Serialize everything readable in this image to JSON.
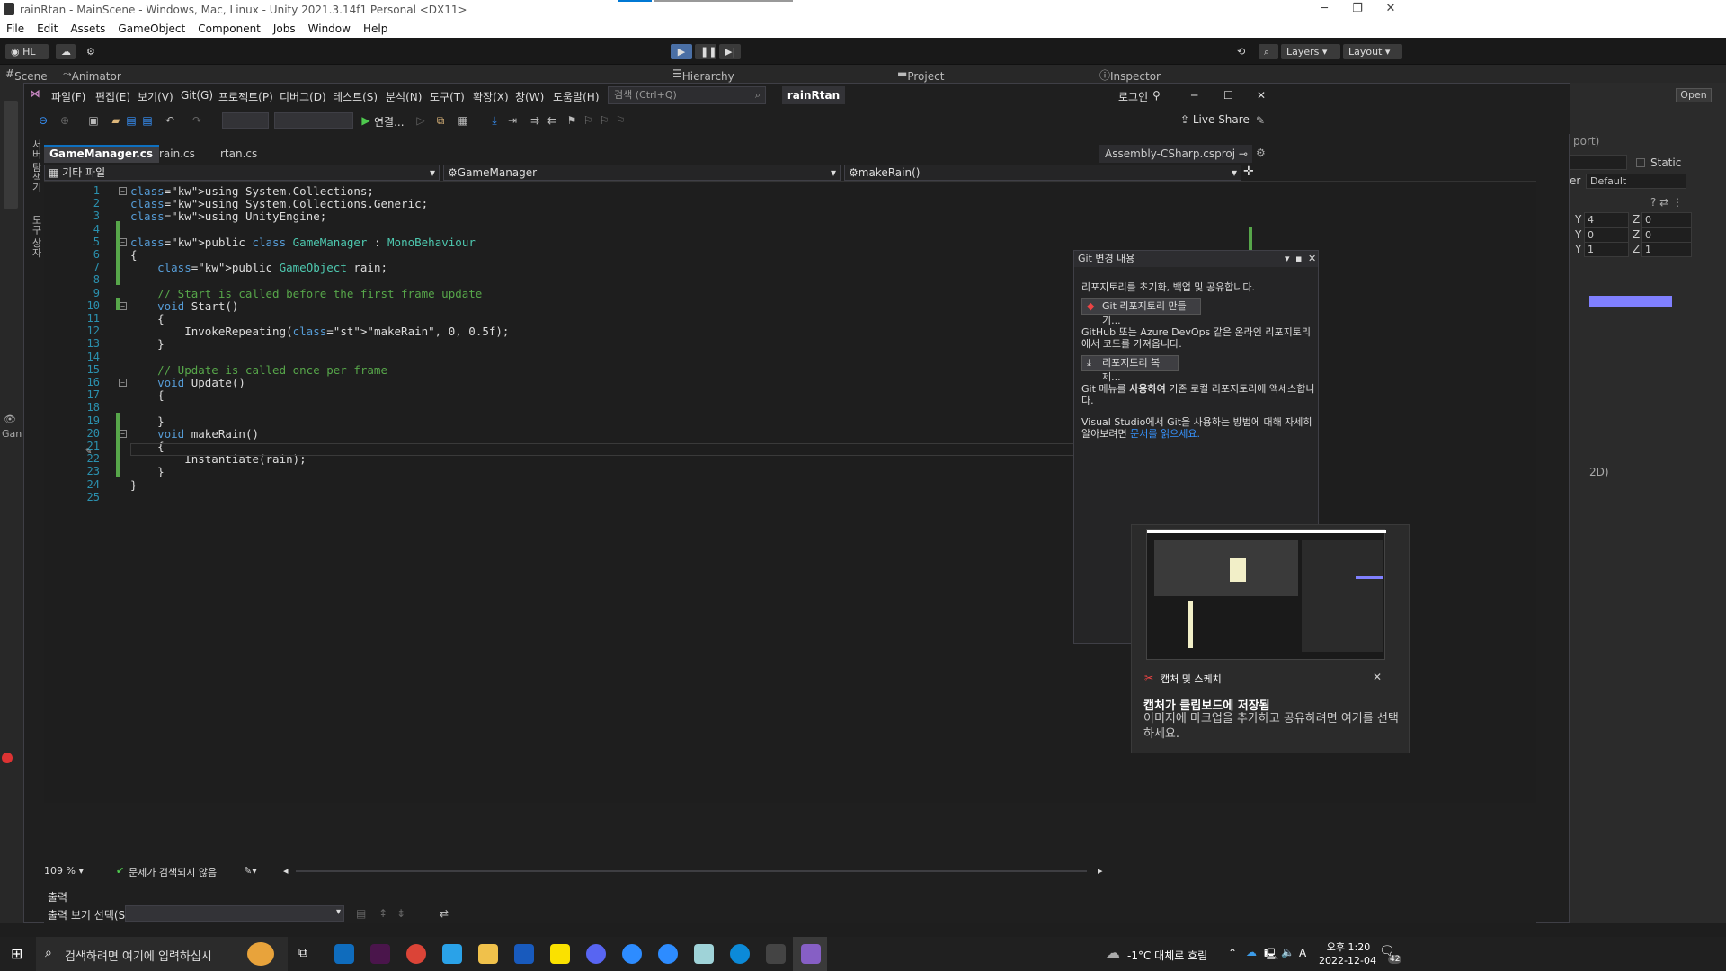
{
  "unity": {
    "window_title": "rainRtan - MainScene - Windows, Mac, Linux - Unity 2021.3.14f1 Personal <DX11>",
    "menu": [
      "File",
      "Edit",
      "Assets",
      "GameObject",
      "Component",
      "Jobs",
      "Window",
      "Help"
    ],
    "account": "HL",
    "layers_label": "Layers",
    "layout_label": "Layout",
    "tabs": {
      "scene": "Scene",
      "animator": "Animator",
      "hierarchy": "Hierarchy",
      "project": "Project",
      "inspector": "Inspector"
    },
    "inspector": {
      "open_btn": "Open",
      "import_hint": "port)",
      "static_label": "Static",
      "layer_label": "er",
      "layer_value": "Default",
      "pos_y": "4",
      "pos_z": "0",
      "rot_y": "0",
      "rot_z": "0",
      "scale_y": "1",
      "scale_z": "1",
      "mode_hint": "2D)"
    },
    "game_label": "Gan"
  },
  "vs": {
    "menu": [
      "파일(F)",
      "편집(E)",
      "보기(V)",
      "Git(G)",
      "프로젝트(P)",
      "디버그(D)",
      "테스트(S)",
      "분석(N)",
      "도구(T)",
      "확장(X)",
      "창(W)",
      "도움말(H)"
    ],
    "search_placeholder": "검색 (Ctrl+Q)",
    "project_name": "rainRtan",
    "login": "로그인",
    "live_share": "Live Share",
    "run_label": "연결...",
    "sidebar_labels": [
      "서버 탐색기",
      "도구 상자"
    ],
    "tabs": [
      {
        "label": "GameManager.cs",
        "active": true
      },
      {
        "label": "rain.cs",
        "active": false
      },
      {
        "label": "rtan.cs",
        "active": false
      }
    ],
    "solution_tab": "Assembly-CSharp.csproj",
    "nav": {
      "left": "기타 파일",
      "middle": "GameManager",
      "right": "makeRain()"
    },
    "code_lines": [
      "using System.Collections;",
      "using System.Collections.Generic;",
      "using UnityEngine;",
      "",
      "public class GameManager : MonoBehaviour",
      "{",
      "    public GameObject rain;",
      "",
      "    // Start is called before the first frame update",
      "    void Start()",
      "    {",
      "        InvokeRepeating(\"makeRain\", 0, 0.5f);",
      "    }",
      "",
      "    // Update is called once per frame",
      "    void Update()",
      "    {",
      "",
      "    }",
      "    void makeRain()",
      "    {",
      "        Instantiate(rain);",
      "    }",
      "}",
      ""
    ],
    "status": {
      "zoom": "109 %",
      "issues": "문제가 검색되지 않음"
    },
    "output": {
      "title": "출력",
      "select_label": "출력 보기 선택(S):"
    }
  },
  "git_panel": {
    "title": "Git 변경 내용",
    "intro": "리포지토리를 초기화, 백업 및 공유합니다.",
    "create_btn": "Git 리포지토리 만들기...",
    "online_text": "GitHub 또는 Azure DevOps 같은 온라인 리포지토리에서 코드를 가져옵니다.",
    "clone_btn": "리포지토리 복제...",
    "menu_text_pre": "Git 메뉴를 ",
    "menu_text_bold": "사용하여",
    "menu_text_post": " 기존 로컬 리포지토리에 액세스합니다.",
    "learn_text": "Visual Studio에서 Git을 사용하는 방법에 대해 자세히 알아보려면 ",
    "learn_link": "문서를 읽으세요."
  },
  "snip_toast": {
    "app": "캡처 및 스케치",
    "title": "캡처가 클립보드에 저장됨",
    "body": "이미지에 마크업을 추가하고 공유하려면 여기를 선택하세요."
  },
  "taskbar": {
    "search_placeholder": "검색하려면 여기에 입력하십시",
    "weather": "-1°C 대체로 흐림",
    "ime": "A",
    "time": "오후 1:20",
    "date": "2022-12-04",
    "notifications": "42"
  },
  "colors": {
    "vs_accent": "#0e70c0",
    "comment": "#57a64a",
    "keyword": "#569cd6",
    "type": "#4ec9b0",
    "string": "#d69d85"
  }
}
